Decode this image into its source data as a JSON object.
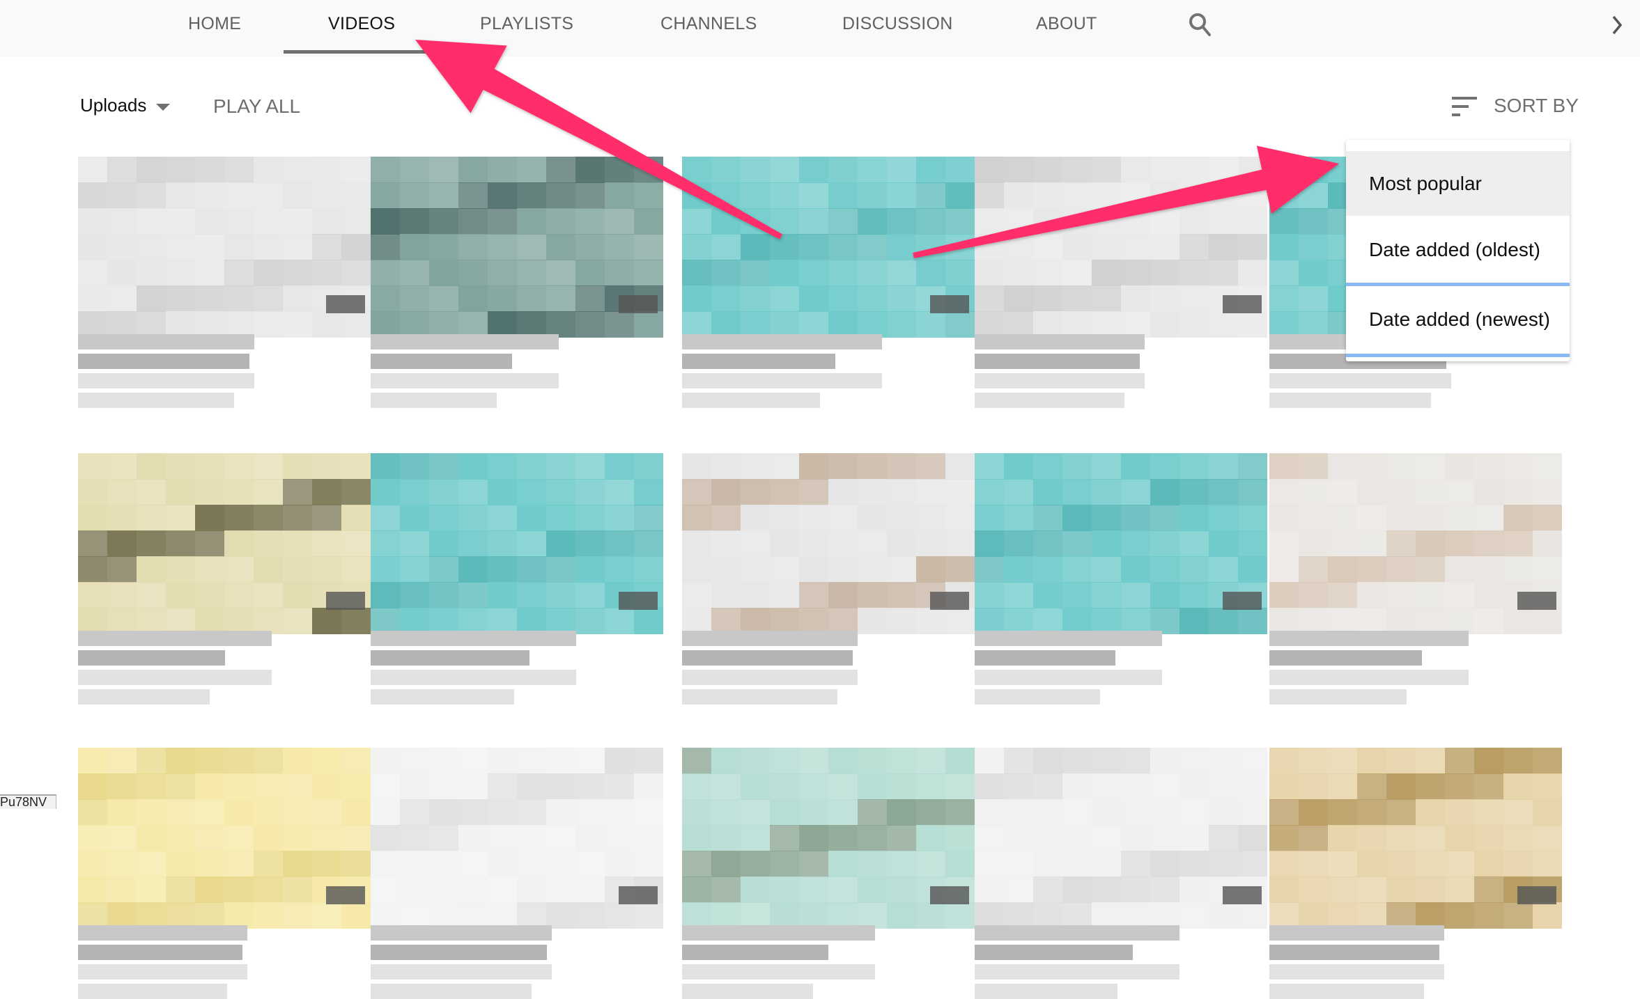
{
  "tabs": {
    "items": [
      {
        "label": "HOME",
        "active": false
      },
      {
        "label": "VIDEOS",
        "active": true
      },
      {
        "label": "PLAYLISTS",
        "active": false
      },
      {
        "label": "CHANNELS",
        "active": false
      },
      {
        "label": "DISCUSSION",
        "active": false
      },
      {
        "label": "ABOUT",
        "active": false
      }
    ],
    "search_icon": "search-icon",
    "next_icon": "chevron-right-icon"
  },
  "toolbar": {
    "uploads_label": "Uploads",
    "play_all_label": "PLAY ALL",
    "sort_by_label": "SORT BY",
    "sort_icon": "sort-icon"
  },
  "sort_menu": {
    "options": [
      {
        "label": "Most popular",
        "highlighted": true
      },
      {
        "label": "Date added (oldest)",
        "highlighted": false
      },
      {
        "label": "Date added (newest)",
        "highlighted": false
      }
    ]
  },
  "annotations": {
    "arrow_color": "#ff2d6a",
    "arrows": [
      {
        "points_to": "VIDEOS tab"
      },
      {
        "points_to": "Most popular option"
      }
    ]
  },
  "status_bar": {
    "url_fragment": "Pu78NV"
  },
  "colors": {
    "tab_bar_bg": "#f9f9f9",
    "active_tab_text": "#111111",
    "inactive_tab_text": "#606060",
    "underline": "#727272",
    "menu_highlight": "#eeeeee",
    "focus_ring": "#8ab8f5",
    "teal_thumb": "#6fcaca"
  },
  "videos": {
    "thumbs": [
      {
        "color": "#e6e6e6",
        "accent": "#d2d2d2"
      },
      {
        "color": "#7fa39c",
        "accent": "#4f706c"
      },
      {
        "color": "#6fcaca",
        "accent": "#5ab9b9"
      },
      {
        "color": "#e8e8e8",
        "accent": "#d0d0d0"
      },
      {
        "color": "#6fcaca",
        "accent": "#5ab9b9"
      },
      {
        "color": "#e4dcb0",
        "accent": "#7a7654"
      },
      {
        "color": "#6fcaca",
        "accent": "#5ab9b9"
      },
      {
        "color": "#e6e6e6",
        "accent": "#c9b8a6"
      },
      {
        "color": "#6fcaca",
        "accent": "#5ab9b9"
      },
      {
        "color": "#e9e6e2",
        "accent": "#d8c8b8"
      },
      {
        "color": "#f6e9a8",
        "accent": "#e8d98a"
      },
      {
        "color": "#f2f2f2",
        "accent": "#e0e0e0"
      },
      {
        "color": "#b5ddd3",
        "accent": "#8aa592"
      },
      {
        "color": "#f0f0f0",
        "accent": "#dcdcdc"
      },
      {
        "color": "#e6d3a8",
        "accent": "#b89b60"
      }
    ]
  }
}
